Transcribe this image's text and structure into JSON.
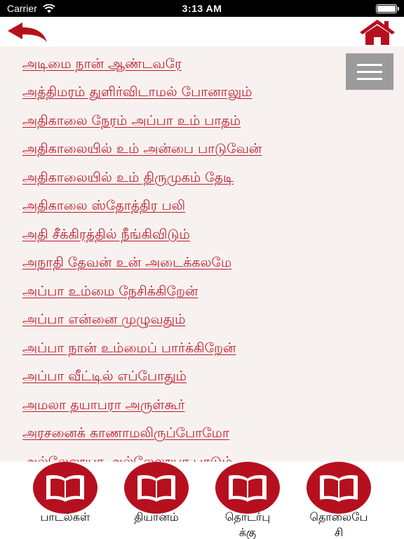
{
  "status": {
    "carrier": "Carrier",
    "time": "3:13 AM"
  },
  "colors": {
    "accent": "#c0192a",
    "tab_circle": "#b6101f",
    "menu_bg": "#8c8c8c"
  },
  "header": {
    "back_icon": "back-arrow-icon",
    "home_icon": "home-icon"
  },
  "songs": [
    "அடிமை நான் ஆண்டவரே",
    "அத்திமரம் துளிர்விடாமல் போனாலும்",
    "அதிகாலை நேரம் அப்பா உம் பாதம்",
    "அதிகாலையில் உம் அன்பை பாடுவேன்",
    "அதிகாலையில் உம் திருமுகம் தேடி",
    "அதிகாலை ஸ்தோத்திர பலி",
    "அதி சீக்கிரத்தில் நீங்கிவிடும்",
    "அநாதி தேவன் உன் அடைக்கலமே",
    "அப்பா உம்மை நேசிக்கிறேன்",
    "அப்பா என்னை முழுவதும்",
    "அப்பா நான் உம்மைப் பார்க்கிறேன்",
    "அப்பா வீட்டில் எப்போதும்",
    "அமலா தயாபரா அருள்கூர்",
    "அரசனைக் காணாமலிருப்போமோ",
    "அல்லேலூயா அல்லேலூயா பாடும்"
  ],
  "tabs": [
    {
      "label": "பாடல்கள்"
    },
    {
      "label": "தியானம்"
    },
    {
      "label": "தொடர்பு\nக்கு"
    },
    {
      "label": "தொலைபே\nசி"
    }
  ]
}
